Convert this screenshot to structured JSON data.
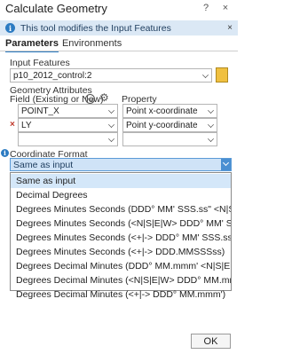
{
  "window": {
    "title": "Calculate Geometry",
    "help_glyph": "?",
    "close_glyph": "×"
  },
  "infobar": {
    "message": "This tool modifies the Input Features",
    "icon": "info-icon",
    "close_glyph": "×",
    "info_glyph": "i"
  },
  "tabs": [
    {
      "label": "Parameters"
    },
    {
      "label": "Environments"
    }
  ],
  "input_features": {
    "label": "Input Features",
    "value": "p10_2012_control:2"
  },
  "geometry_attributes": {
    "label": "Geometry Attributes",
    "field_header": "Field (Existing or New)",
    "property_header": "Property",
    "rows": [
      {
        "field": "POINT_X",
        "property": "Point x-coordinate",
        "removable": false
      },
      {
        "field": "LY",
        "property": "Point y-coordinate",
        "removable": true
      },
      {
        "field": "",
        "property": "",
        "removable": false
      }
    ],
    "remove_glyph": "×"
  },
  "coordinate_format": {
    "label": "Coordinate Format",
    "selected": "Same as input",
    "options": [
      "Same as input",
      "Decimal Degrees",
      "Degrees Minutes Seconds (DDD° MM' SSS.ss\" <N|S|E|W>)",
      "Degrees Minutes Seconds (<N|S|E|W> DDD° MM' SSS.ss\")",
      "Degrees Minutes Seconds (<+|-> DDD° MM' SSS.ss\")",
      "Degrees Minutes Seconds (<+|-> DDD.MMSSSss)",
      "Degrees Decimal Minutes (DDD° MM.mmm' <N|S|E|W>)",
      "Degrees Decimal Minutes (<N|S|E|W> DDD° MM.mmm')",
      "Degrees Decimal Minutes (<+|-> DDD° MM.mmm')"
    ]
  },
  "footer": {
    "ok_label": "OK"
  },
  "colors": {
    "accent": "#2c7bc2",
    "info_bg": "#dbe8f5",
    "selected_bg": "#d4e7f9",
    "remove": "#c0392b"
  }
}
